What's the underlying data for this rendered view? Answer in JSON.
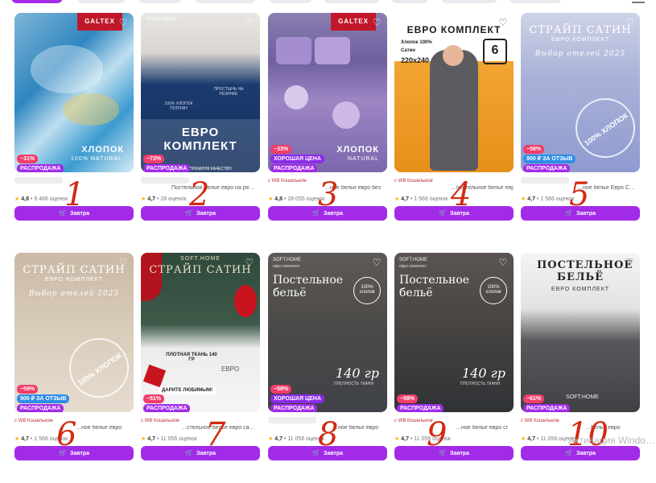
{
  "common": {
    "delivery_label": "Завтра",
    "cart_icon": "cart-icon",
    "heart_icon": "heart-icon"
  },
  "colors": {
    "accent": "#a22be8",
    "discount": "#f23c6a",
    "number_marker": "#d22a12"
  },
  "products": [
    {
      "number": "1",
      "overlay": "ХЛОПОК",
      "overlay_sub": "100% NATURAL",
      "brand": "GALTEX",
      "discount": "−31%",
      "sale": "РАСПРОДАЖА",
      "shop": "",
      "title": "",
      "rating": "4,8",
      "reviews": "9 486 оценок"
    },
    {
      "number": "2",
      "overlay": "ЕВРО КОМПЛЕКТ",
      "overlay_sub": "ПРЕМИУМ КАЧЕСТВО",
      "top_text": "ТЕМНО-СИНИЙ",
      "note1": "100% ХЛОПОК ПОПЛИН",
      "note2": "ПРОСТЫНЬ НА РЕЗИНКЕ",
      "discount": "−73%",
      "sale": "РАСПРОДАЖА",
      "shop": "",
      "title": "Постельное белье евро на ре…",
      "rating": "4,7",
      "reviews": "28 оценок"
    },
    {
      "number": "3",
      "overlay": "ХЛОПОК",
      "overlay_sub": "NATURAL",
      "brand": "GALTEX",
      "discount": "−33%",
      "good": "ХОРОШАЯ ЦЕНА",
      "sale": "РАСПРОДАЖА",
      "shop": "с WB Кошельком",
      "title": "…ное белье евро без",
      "rating": "4,8",
      "reviews": "28 055 оценок"
    },
    {
      "number": "4",
      "overlay": "ЕВРО КОМПЛЕКТ",
      "spec1": "Хлопок 100%",
      "spec2": "Сатин",
      "spec3": "220х240",
      "box_num": "6",
      "shop": "с WB Кошельком",
      "title": "…постельное белье евро С…",
      "rating": "4,7",
      "reviews": "1 566 оценок"
    },
    {
      "number": "5",
      "overlay": "СТРАЙП САТИН",
      "overlay_sub": "ЕВРО КОМПЛЕКТ",
      "script": "Выбор отелей 2025",
      "stamp": "100% ХЛОПОК",
      "discount": "−58%",
      "review": "900 ₽ ЗА ОТЗЫВ",
      "sale": "РАСПРОДАЖА",
      "shop": "",
      "title": "…ное белье Евро С…",
      "rating": "4,7",
      "reviews": "1 566 оценок"
    },
    {
      "number": "6",
      "overlay": "СТРАЙП САТИН",
      "overlay_sub": "ЕВРО КОМПЛЕКТ",
      "script": "Выбор отелей 2025",
      "stamp": "100% ХЛОПОК",
      "discount": "−59%",
      "review": "900 ₽ ЗА ОТЗЫВ",
      "sale": "РАСПРОДАЖА",
      "shop": "с WB Кошельком",
      "title": "…ное белье евро",
      "rating": "4,7",
      "reviews": "1 566 оценок"
    },
    {
      "number": "7",
      "overlay": "СТРАЙП САТИН",
      "overlay_sub": "SOFT.HOME",
      "note1": "ПЛОТНАЯ ТКАНЬ 140 ГР",
      "note2": "ЕВРО",
      "gift": "ДАРИТЕ ЛЮБИМЫМ!",
      "discount": "−51%",
      "sale": "РАСПРОДАЖА",
      "shop": "с WB Кошельком",
      "title": "…стельное белье евро са…",
      "rating": "4,7",
      "reviews": "11 056 оценок"
    },
    {
      "number": "8",
      "overlay": "Постельное бельё",
      "overlay_sub": "SOFT.HOME",
      "top_text": "евро комплект",
      "stamp": "100% хлопок",
      "density": "140 гр",
      "density_sub": "ПЛОТНОСТЬ ТКАНИ",
      "discount": "−58%",
      "good": "ХОРОШАЯ ЦЕНА",
      "sale": "РАСПРОДАЖА",
      "shop": "",
      "title": "…ное белье евро",
      "rating": "4,7",
      "reviews": "11 056 оценок"
    },
    {
      "number": "9",
      "overlay": "Постельное бельё",
      "overlay_sub": "SOFT.HOME",
      "top_text": "евро комплект",
      "stamp": "100% хлопок",
      "density": "140 гр",
      "density_sub": "ПЛОТНОСТЬ ТКАНИ",
      "discount": "−59%",
      "sale": "РАСПРОДАЖА",
      "shop": "с WB Кошельком",
      "title": "…ное белье евро сг",
      "rating": "4,7",
      "reviews": "11 056 оценок"
    },
    {
      "number": "10",
      "overlay": "ПОСТЕЛЬНОЕ БЕЛЬЁ",
      "overlay_sub": "ЕВРО КОМПЛЕКТ",
      "brand_bottom": "SOFT.HOME",
      "discount": "−61%",
      "sale": "РАСПРОДАЖА",
      "shop": "с WB Кошельком",
      "title": "…белье евро",
      "rating": "4,7",
      "reviews": "11 056 оценок"
    }
  ],
  "watermark": "Активация Windo…"
}
